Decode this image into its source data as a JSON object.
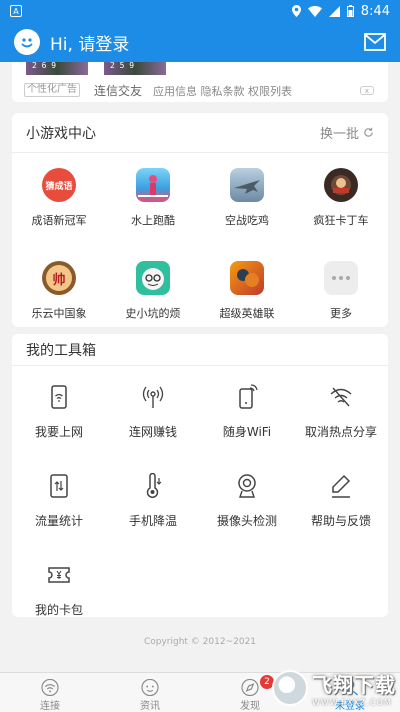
{
  "status_bar": {
    "time": "8:44",
    "left_icon_letter": "A"
  },
  "header": {
    "title": "Hi, 请登录"
  },
  "ad": {
    "image_counts": [
      "2 6 9",
      "2 5 9"
    ],
    "tag": "个性化广告",
    "title": "连信交友",
    "links": "应用信息 隐私条款 权限列表",
    "close_label": "x"
  },
  "games": {
    "title": "小游戏中心",
    "refresh_label": "换一批",
    "items": [
      {
        "label": "成语新冠军",
        "icon": "idiom-game-icon",
        "icon_text": "猜成语"
      },
      {
        "label": "水上跑酷",
        "icon": "water-parkour-icon"
      },
      {
        "label": "空战吃鸡",
        "icon": "air-battle-icon"
      },
      {
        "label": "疯狂卡丁车",
        "icon": "kart-icon"
      },
      {
        "label": "乐云中国象",
        "icon": "chinese-chess-icon",
        "icon_text": "帅"
      },
      {
        "label": "史小坑的烦",
        "icon": "shi-xiaokeng-icon"
      },
      {
        "label": "超级英雄联",
        "icon": "superhero-icon"
      },
      {
        "label": "更多",
        "icon": "more-dots-icon"
      }
    ]
  },
  "tools": {
    "title": "我的工具箱",
    "items": [
      {
        "label": "我要上网",
        "icon": "phone-wifi-icon"
      },
      {
        "label": "连网赚钱",
        "icon": "signal-tower-icon"
      },
      {
        "label": "随身WiFi",
        "icon": "portable-wifi-icon"
      },
      {
        "label": "取消热点分享",
        "icon": "wifi-off-icon"
      },
      {
        "label": "流量统计",
        "icon": "data-usage-icon"
      },
      {
        "label": "手机降温",
        "icon": "thermometer-icon"
      },
      {
        "label": "摄像头检测",
        "icon": "camera-detect-icon"
      },
      {
        "label": "帮助与反馈",
        "icon": "edit-feedback-icon"
      },
      {
        "label": "我的卡包",
        "icon": "card-wallet-icon"
      }
    ]
  },
  "copyright": "Copyright © 2012~2021",
  "tabbar": {
    "items": [
      {
        "label": "连接",
        "icon": "wifi-icon"
      },
      {
        "label": "资讯",
        "icon": "news-face-icon"
      },
      {
        "label": "发现",
        "icon": "compass-icon",
        "badge": "2"
      },
      {
        "label": "未登录",
        "icon": "profile-icon"
      }
    ]
  },
  "watermark": {
    "main": "飞翔下载",
    "sub": "WWW.FXXZ.COM"
  },
  "colors": {
    "primary": "#1c8ce6",
    "background": "#f2f2f2",
    "badge": "#e53935"
  }
}
